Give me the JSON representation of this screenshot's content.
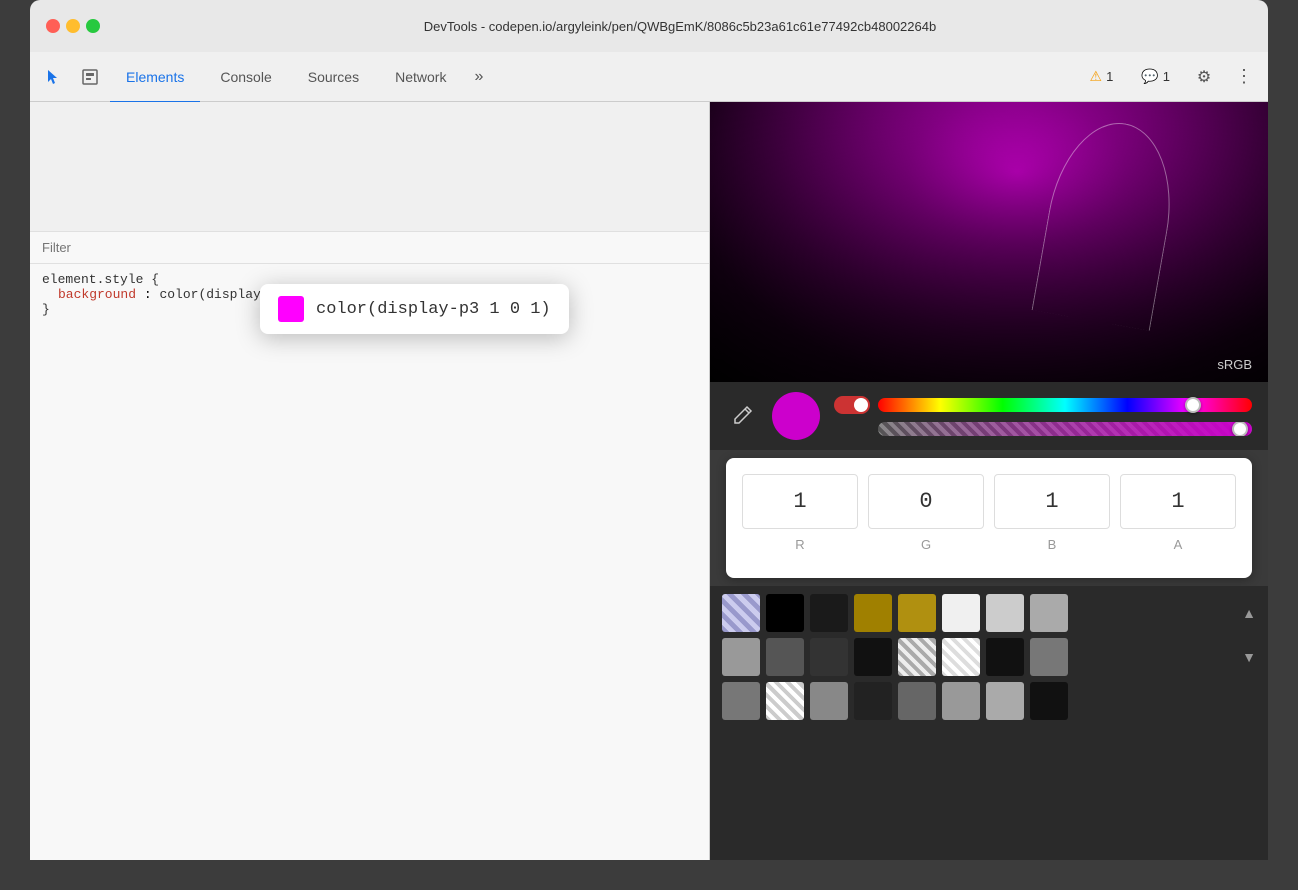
{
  "titlebar": {
    "title": "DevTools - codepen.io/argyleink/pen/QWBgEmK/8086c5b23a61c61e77492cb48002264b"
  },
  "tabs": {
    "items": [
      {
        "label": "Elements",
        "active": true
      },
      {
        "label": "Console",
        "active": false
      },
      {
        "label": "Sources",
        "active": false
      },
      {
        "label": "Network",
        "active": false
      },
      {
        "label": "»",
        "active": false
      }
    ]
  },
  "badges": {
    "warning_count": "1",
    "message_count": "1"
  },
  "filter": {
    "placeholder": "Filter"
  },
  "style_rule": {
    "selector": "element.style {",
    "property": "background",
    "colon": ":",
    "value": "color(display-p3 1 0 1)",
    "close": "}"
  },
  "color_tooltip": {
    "text": "color(display-p3 1 0 1)"
  },
  "srgb_label": "sRGB",
  "rgba": {
    "r_label": "R",
    "g_label": "G",
    "b_label": "B",
    "a_label": "A",
    "r_value": "1",
    "g_value": "0",
    "b_value": "1",
    "a_value": "1"
  },
  "swatches": {
    "row1": [
      {
        "color": "#8888cc",
        "type": "checker"
      },
      {
        "color": "#000000"
      },
      {
        "color": "#1a1a1a"
      },
      {
        "color": "#a08000"
      },
      {
        "color": "#b09000"
      },
      {
        "color": "#f5f5f5"
      },
      {
        "color": "#cccccc"
      },
      {
        "color": "#aaaaaa"
      }
    ],
    "row2": [
      {
        "color": "#aaaaaa"
      },
      {
        "color": "#555555"
      },
      {
        "color": "#333333"
      },
      {
        "color": "#111111"
      },
      {
        "color": "#444444",
        "type": "checker-light"
      },
      {
        "color": "#cccccc",
        "type": "checker-light"
      },
      {
        "color": "#111111"
      },
      {
        "color": "#888888"
      }
    ],
    "row3": [
      {
        "color": "#888888"
      },
      {
        "color": "#cccccc",
        "type": "checker-light2"
      },
      {
        "color": "#999999"
      },
      {
        "color": "#222222"
      },
      {
        "color": "#777777"
      },
      {
        "color": "#999999"
      },
      {
        "color": "#aaaaaa"
      },
      {
        "color": "#111111"
      }
    ]
  }
}
